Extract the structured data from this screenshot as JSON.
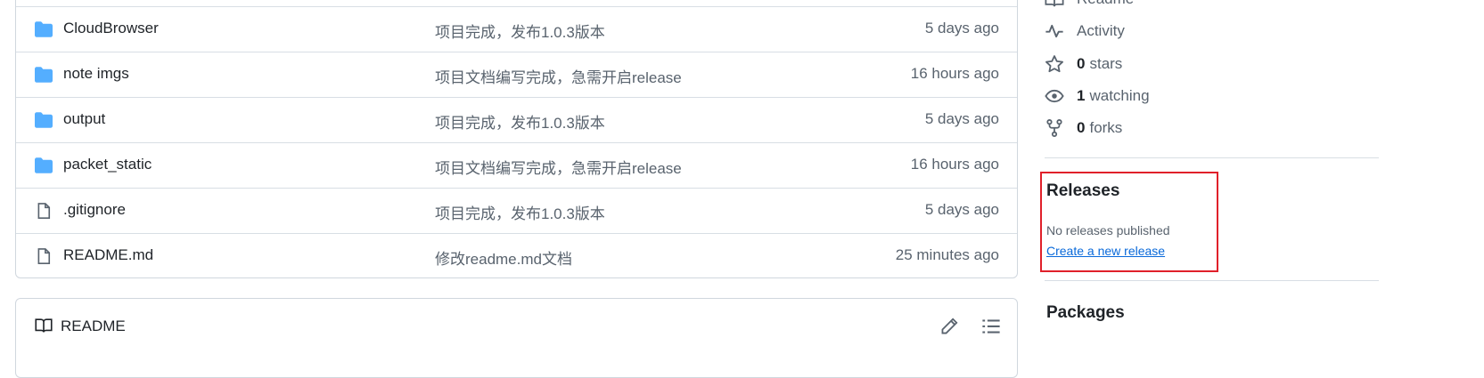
{
  "files": [
    {
      "name": "CloudBrowser",
      "type": "folder",
      "message": "项目完成，发布1.0.3版本",
      "date": "5 days ago"
    },
    {
      "name": "note imgs",
      "type": "folder",
      "message": "项目文档编写完成，急需开启release",
      "date": "16 hours ago"
    },
    {
      "name": "output",
      "type": "folder",
      "message": "项目完成，发布1.0.3版本",
      "date": "5 days ago"
    },
    {
      "name": "packet_static",
      "type": "folder",
      "message": "项目文档编写完成，急需开启release",
      "date": "16 hours ago"
    },
    {
      "name": ".gitignore",
      "type": "file",
      "message": "项目完成，发布1.0.3版本",
      "date": "5 days ago"
    },
    {
      "name": "README.md",
      "type": "file",
      "message": "修改readme.md文档",
      "date": "25 minutes ago"
    }
  ],
  "readme": {
    "title": "README"
  },
  "sidebar": {
    "readme_label": "Readme",
    "activity_label": "Activity",
    "stars": {
      "count": "0",
      "label": "stars"
    },
    "watching": {
      "count": "1",
      "label": "watching"
    },
    "forks": {
      "count": "0",
      "label": "forks"
    }
  },
  "releases": {
    "title": "Releases",
    "empty_text": "No releases published",
    "create_link": "Create a new release"
  },
  "packages": {
    "title": "Packages"
  },
  "colors": {
    "folder": "#54aeff",
    "link": "#0969da",
    "highlight": "#e0202a"
  }
}
